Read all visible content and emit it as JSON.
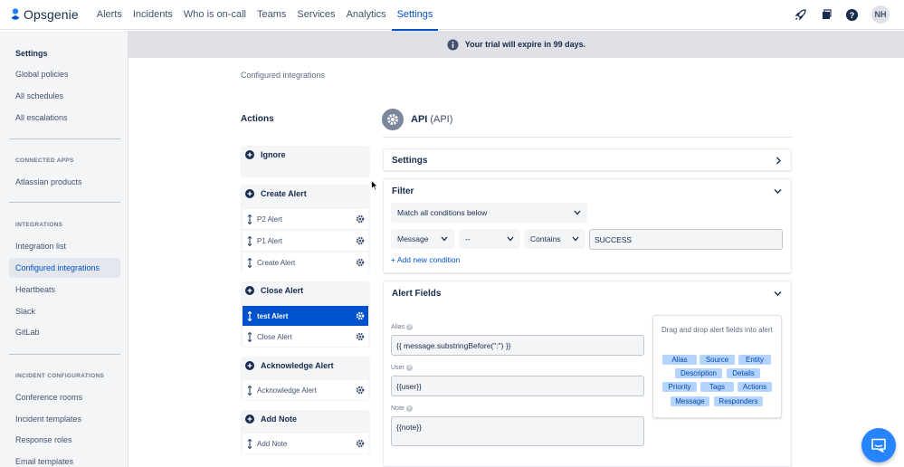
{
  "app": {
    "name": "Opsgenie"
  },
  "nav": {
    "items": [
      "Alerts",
      "Incidents",
      "Who is on-call",
      "Teams",
      "Services",
      "Analytics",
      "Settings"
    ],
    "active": "Settings",
    "avatar_initials": "NH"
  },
  "sidebar": {
    "top": [
      "Settings",
      "Global policies",
      "All schedules",
      "All escalations"
    ],
    "connected_apps_heading": "CONNECTED APPS",
    "connected_apps": [
      "Atlassian products"
    ],
    "integrations_heading": "INTEGRATIONS",
    "integrations": [
      "Integration list",
      "Configured integrations",
      "Heartbeats",
      "Slack",
      "GitLab"
    ],
    "incident_heading": "INCIDENT CONFIGURATIONS",
    "incident": [
      "Conference rooms",
      "Incident templates",
      "Response roles",
      "Email templates"
    ]
  },
  "banner": {
    "text": "Your trial will expire in 99 days."
  },
  "breadcrumb": "Configured integrations",
  "actions": {
    "title": "Actions",
    "ignore": "Ignore",
    "create_alert": {
      "label": "Create Alert",
      "items": [
        "P2 Alert",
        "P1 Alert",
        "Create Alert"
      ]
    },
    "close_alert": {
      "label": "Close Alert",
      "items": [
        "test Alert",
        "Close Alert"
      ],
      "selected": "test Alert"
    },
    "acknowledge_alert": {
      "label": "Acknowledge Alert",
      "items": [
        "Acknowledge Alert"
      ]
    },
    "add_note": {
      "label": "Add Note",
      "items": [
        "Add Note"
      ]
    }
  },
  "integration": {
    "name": "API",
    "type": "(API)"
  },
  "settings_section": {
    "title": "Settings"
  },
  "filter": {
    "title": "Filter",
    "match": "Match all conditions below",
    "field": "Message",
    "not": "--",
    "operator": "Contains",
    "value": "SUCCESS",
    "add_condition": "+ Add new condition"
  },
  "alert_fields": {
    "title": "Alert Fields",
    "alias_label": "Alias",
    "alias_value": "{{ message.substringBefore(\":\") }}",
    "user_label": "User",
    "user_value": "{{user}}",
    "note_label": "Note",
    "note_value": "{{note}}",
    "dnd_text": "Drag and drop alert fields into alert",
    "tags": [
      "Alias",
      "Source",
      "Entity",
      "Description",
      "Details",
      "Priority",
      "Tags",
      "Actions",
      "Message",
      "Responders"
    ]
  },
  "colors": {
    "primary": "#0052cc",
    "tag_bg": "#b3d4ff",
    "banner_bg": "#dfe1e6",
    "chat": "#2684ff"
  }
}
